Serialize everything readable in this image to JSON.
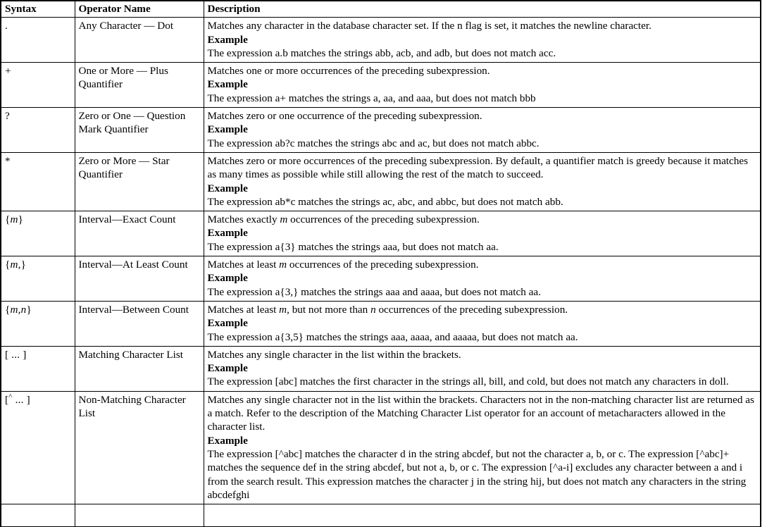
{
  "table": {
    "headers": {
      "syntax": "Syntax",
      "operator_name": "Operator Name",
      "description": "Description"
    },
    "example_label": "Example",
    "rows": [
      {
        "syntax": ".",
        "syntax_parts": [
          {
            "t": ".",
            "i": false
          }
        ],
        "operator_name": "Any Character — Dot",
        "desc_main": "Matches any character in the database character set. If the n flag is set, it matches the newline character.",
        "desc_example": "The expression a.b matches the strings abb, acb, and adb, but does not match acc."
      },
      {
        "syntax": "+",
        "syntax_parts": [
          {
            "t": "+",
            "i": false
          }
        ],
        "operator_name": "One or More — Plus Quantifier",
        "desc_main": "Matches one or more occurrences of the preceding subexpression.",
        "desc_example": "The expression a+ matches the strings a, aa, and aaa, but does not match bbb"
      },
      {
        "syntax": "?",
        "syntax_parts": [
          {
            "t": "?",
            "i": false
          }
        ],
        "operator_name": "Zero or One — Question Mark Quantifier",
        "desc_main": "Matches zero or one occurrence of the preceding subexpression.",
        "desc_example": "The expression ab?c matches the strings abc and ac, but does not match abbc."
      },
      {
        "syntax": "*",
        "syntax_parts": [
          {
            "t": "*",
            "i": false
          }
        ],
        "operator_name": "Zero or More — Star Quantifier",
        "desc_main": "Matches zero or more occurrences of the preceding subexpression. By default, a quantifier match is greedy because it matches as many times as possible while still allowing the rest of the match to succeed.",
        "desc_example": "The expression ab*c matches the strings ac, abc, and abbc, but does not match abb."
      },
      {
        "syntax": "{m}",
        "syntax_parts": [
          {
            "t": "{",
            "i": false
          },
          {
            "t": "m",
            "i": true
          },
          {
            "t": "}",
            "i": false
          }
        ],
        "operator_name": "Interval—Exact Count",
        "desc_main_parts": [
          {
            "t": "Matches exactly ",
            "i": false
          },
          {
            "t": "m",
            "i": true
          },
          {
            "t": " occurrences of the preceding subexpression.",
            "i": false
          }
        ],
        "desc_main": "Matches exactly m occurrences of the preceding subexpression.",
        "desc_example": "The expression a{3} matches the strings aaa, but does not match aa."
      },
      {
        "syntax": "{m,}",
        "syntax_parts": [
          {
            "t": "{",
            "i": false
          },
          {
            "t": "m",
            "i": true
          },
          {
            "t": ",}",
            "i": false
          }
        ],
        "operator_name": "Interval—At Least Count",
        "desc_main_parts": [
          {
            "t": "Matches at least ",
            "i": false
          },
          {
            "t": "m",
            "i": true
          },
          {
            "t": " occurrences of the preceding subexpression.",
            "i": false
          }
        ],
        "desc_main": "Matches at least m occurrences of the preceding subexpression.",
        "desc_example": "The expression a{3,} matches the strings aaa and aaaa, but does not match aa."
      },
      {
        "syntax": "{m,n}",
        "syntax_parts": [
          {
            "t": "{",
            "i": false
          },
          {
            "t": "m",
            "i": true
          },
          {
            "t": ",",
            "i": false
          },
          {
            "t": "n",
            "i": true
          },
          {
            "t": "}",
            "i": false
          }
        ],
        "operator_name": "Interval—Between Count",
        "desc_main_parts": [
          {
            "t": "Matches at least ",
            "i": false
          },
          {
            "t": "m",
            "i": true
          },
          {
            "t": ", but not more than ",
            "i": false
          },
          {
            "t": "n",
            "i": true
          },
          {
            "t": " occurrences of the preceding subexpression.",
            "i": false
          }
        ],
        "desc_main": "Matches at least m, but not more than n occurrences of the preceding subexpression.",
        "desc_example": "The expression a{3,5} matches the strings aaa, aaaa, and aaaaa, but does not match aa."
      },
      {
        "syntax": "[ ... ]",
        "syntax_parts": [
          {
            "t": "[ ... ]",
            "i": false
          }
        ],
        "operator_name": "Matching Character List",
        "desc_main": "Matches any single character in the list within the brackets.",
        "desc_example": "The expression [abc] matches the first character in the strings all, bill, and cold, but does not match any characters in doll."
      },
      {
        "syntax": "[^ ... ]",
        "syntax_parts": [
          {
            "t": "[",
            "i": false
          },
          {
            "t": "^",
            "i": false,
            "sup": true
          },
          {
            "t": " ... ]",
            "i": false
          }
        ],
        "operator_name": "Non-Matching Character List",
        "desc_main": "Matches any single character not in the list within the brackets. Characters not in the non-matching character list are returned as a match. Refer to the description of the Matching Character List operator for an account of metacharacters allowed in the character list.",
        "desc_example": "The expression [^abc] matches the character d in the string abcdef, but not the character a, b, or c. The expression [^abc]+ matches the sequence def in the string abcdef, but not a, b, or c.   The expression [^a-i] excludes any character between a and i from the search result. This expression matches the character j in the string hij, but does not match any characters in the string abcdefghi"
      }
    ],
    "partial_row": {
      "syntax": "",
      "operator_name": "",
      "description": ""
    }
  }
}
